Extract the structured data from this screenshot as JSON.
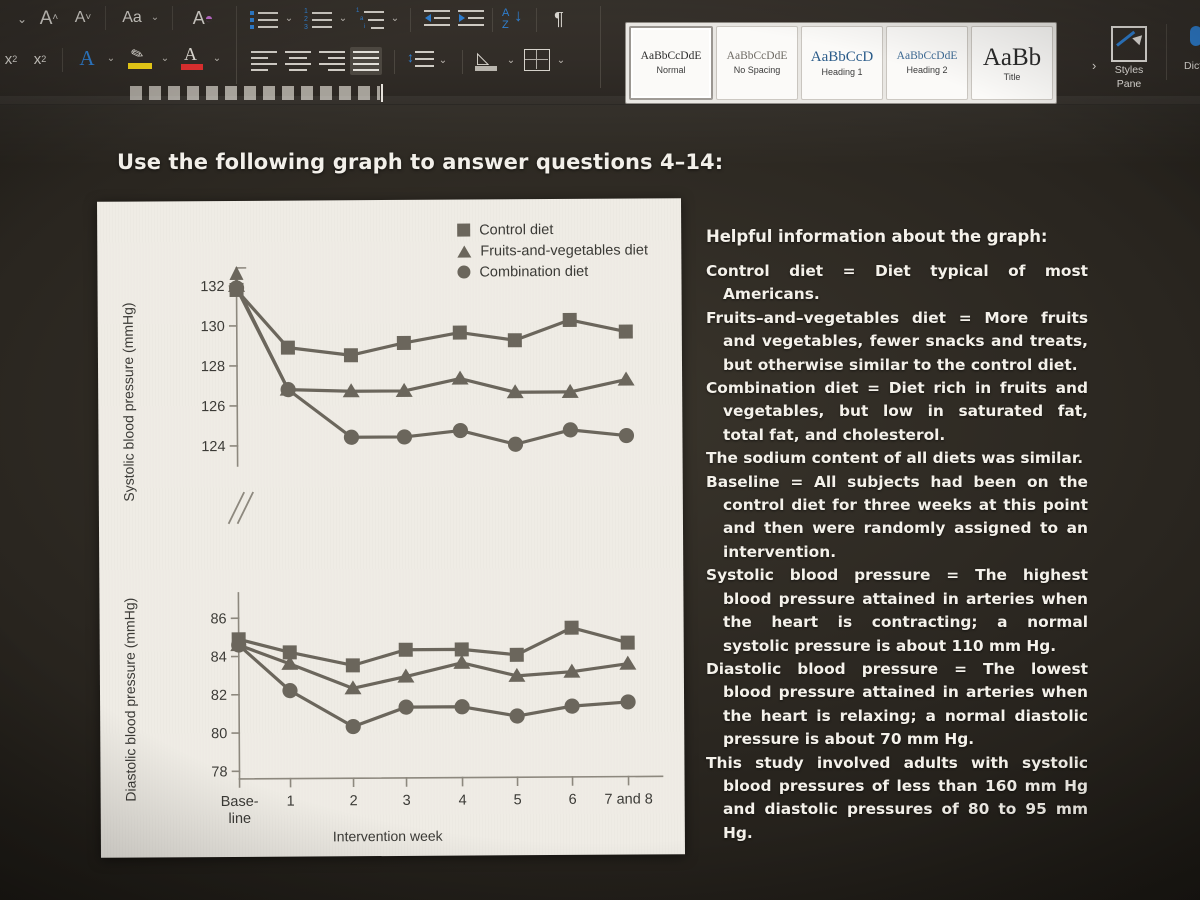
{
  "ribbon": {
    "row1": [
      {
        "name": "font-size-chevron-icon",
        "glyph": "⌄"
      },
      {
        "name": "grow-font-icon",
        "glyph": "A˄"
      },
      {
        "name": "shrink-font-icon",
        "glyph": "A˅"
      },
      {
        "name": "change-case-button",
        "glyph": "Aa"
      },
      {
        "name": "change-case-chevron-icon",
        "glyph": "⌄"
      },
      {
        "name": "clear-formatting-icon",
        "glyph": "A"
      }
    ],
    "row2": [
      {
        "name": "subscript-icon",
        "glyph": "x₂"
      },
      {
        "name": "superscript-icon",
        "glyph": "x²"
      },
      {
        "name": "text-effects-icon",
        "glyph": "A"
      },
      {
        "name": "text-effects-chevron-icon",
        "glyph": "⌄"
      },
      {
        "name": "highlight-color-icon",
        "glyph": "✎"
      },
      {
        "name": "highlight-chevron-icon",
        "glyph": "⌄"
      },
      {
        "name": "font-color-icon",
        "glyph": "A"
      },
      {
        "name": "font-color-chevron-icon",
        "glyph": "⌄"
      }
    ],
    "paragraph": [
      {
        "name": "bullets-button",
        "chevron": "⌄"
      },
      {
        "name": "numbering-button",
        "chevron": "⌄"
      },
      {
        "name": "multilevel-list-button",
        "chevron": "⌄"
      },
      {
        "name": "decrease-indent-button",
        "chevron": ""
      },
      {
        "name": "increase-indent-button",
        "chevron": ""
      },
      {
        "name": "sort-button",
        "glyph": "A\nZ↓"
      },
      {
        "name": "show-formatting-marks-button",
        "glyph": "¶"
      },
      {
        "name": "align-left-button",
        "chevron": ""
      },
      {
        "name": "align-center-button",
        "chevron": ""
      },
      {
        "name": "align-right-button",
        "chevron": ""
      },
      {
        "name": "justify-button",
        "chevron": ""
      },
      {
        "name": "line-spacing-button",
        "chevron": "⌄"
      },
      {
        "name": "shading-button",
        "chevron": "⌄"
      },
      {
        "name": "borders-button",
        "chevron": "⌄"
      }
    ],
    "sort_letters": {
      "top": "A",
      "bottom": "Z"
    },
    "pilcrow": "¶",
    "styles": [
      {
        "sample": "AaBbCcDdE",
        "label": "Normal",
        "selected": true
      },
      {
        "sample": "AaBbCcDdE",
        "label": "No Spacing",
        "selected": false
      },
      {
        "sample": "AaBbCcD",
        "label": "Heading 1",
        "selected": false
      },
      {
        "sample": "AaBbCcDdE",
        "label": "Heading 2",
        "selected": false
      },
      {
        "sample": "AaBb",
        "label": "Title",
        "selected": false
      }
    ],
    "gallery_more": "›",
    "styles_pane_label": "Styles\nPane",
    "styles_pane_line1": "Styles",
    "styles_pane_line2": "Pane",
    "dictate_label": "Dicta"
  },
  "slide": {
    "title": "Use the following graph to answer questions 4–14:",
    "info_heading": "Helpful information about the graph:",
    "info_paragraphs": [
      "Control diet = Diet typical of most Americans.",
      "Fruits–and–vegetables diet = More fruits and vegetables, fewer snacks and treats, but otherwise similar to the control diet.",
      "Combination diet = Diet rich in fruits and vegetables, but low in saturated fat, total fat, and cholesterol.",
      "The sodium content of all diets was similar.",
      "Baseline = All subjects had been on the control diet for three weeks at this point and then were randomly assigned to an intervention.",
      "Systolic blood pressure = The highest blood pressure attained in arteries when the heart is contracting; a normal systolic pressure is about 110 mm Hg.",
      "Diastolic blood pressure = The lowest blood pressure attained in arteries when the heart is relaxing; a normal diastolic pressure is about 70 mm Hg.",
      "This study involved adults with systolic blood pressures of less than 160 mm Hg and diastolic pressures of 80 to 95 mm Hg."
    ]
  },
  "chart_data": [
    {
      "type": "line",
      "title": "",
      "panel": "upper",
      "xlabel": "Intervention week",
      "ylabel": "Systolic blood pressure (mmHg)",
      "categories": [
        "Base-line",
        "1",
        "2",
        "3",
        "4",
        "5",
        "6",
        "7 and 8"
      ],
      "yticks": [
        132,
        130,
        128,
        126,
        124
      ],
      "ylim": [
        123.0,
        132.4
      ],
      "grid": false,
      "axis_break": true,
      "legend_position": "top-right",
      "series": [
        {
          "name": "Control diet",
          "marker": "square",
          "values": [
            131.8,
            128.9,
            128.5,
            129.1,
            129.6,
            129.2,
            130.2,
            129.6
          ]
        },
        {
          "name": "Fruits-and-vegetables diet",
          "marker": "triangle",
          "values": [
            132.0,
            126.8,
            126.7,
            126.7,
            127.3,
            126.6,
            126.6,
            127.2
          ]
        },
        {
          "name": "Combination diet",
          "marker": "circle",
          "values": [
            131.9,
            126.8,
            124.4,
            124.4,
            124.7,
            124.0,
            124.7,
            124.4
          ]
        }
      ]
    },
    {
      "type": "line",
      "title": "",
      "panel": "lower",
      "xlabel": "Intervention week",
      "ylabel": "Diastolic blood pressure (mmHg)",
      "categories": [
        "Base-line",
        "1",
        "2",
        "3",
        "4",
        "5",
        "6",
        "7 and 8"
      ],
      "yticks": [
        86,
        84,
        82,
        80,
        78
      ],
      "ylim": [
        77.6,
        86.8
      ],
      "grid": false,
      "axis_break": true,
      "legend_position": "top-right",
      "series": [
        {
          "name": "Control diet",
          "marker": "square",
          "values": [
            84.9,
            84.2,
            83.5,
            84.3,
            84.3,
            84.0,
            85.4,
            84.6
          ]
        },
        {
          "name": "Fruits-and-vegetables diet",
          "marker": "triangle",
          "values": [
            84.6,
            83.6,
            82.3,
            82.9,
            83.6,
            82.9,
            83.1,
            83.5
          ]
        },
        {
          "name": "Combination diet",
          "marker": "circle",
          "values": [
            84.6,
            82.2,
            80.3,
            81.3,
            81.3,
            80.8,
            81.3,
            81.5
          ]
        }
      ]
    }
  ],
  "chart_legend": [
    {
      "marker": "square",
      "label": "Control diet"
    },
    {
      "marker": "triangle",
      "label": "Fruits-and-vegetables diet"
    },
    {
      "marker": "circle",
      "label": "Combination diet"
    }
  ],
  "colors": {
    "marker": "#6b665c",
    "axis": "#8d887e",
    "card": "#efece5",
    "slide_bg": "#2a2620",
    "text_light": "#f4f1ea",
    "accent_blue": "#2f7fd0",
    "highlight_yellow": "#f2d318",
    "font_color_red": "#e03030"
  }
}
